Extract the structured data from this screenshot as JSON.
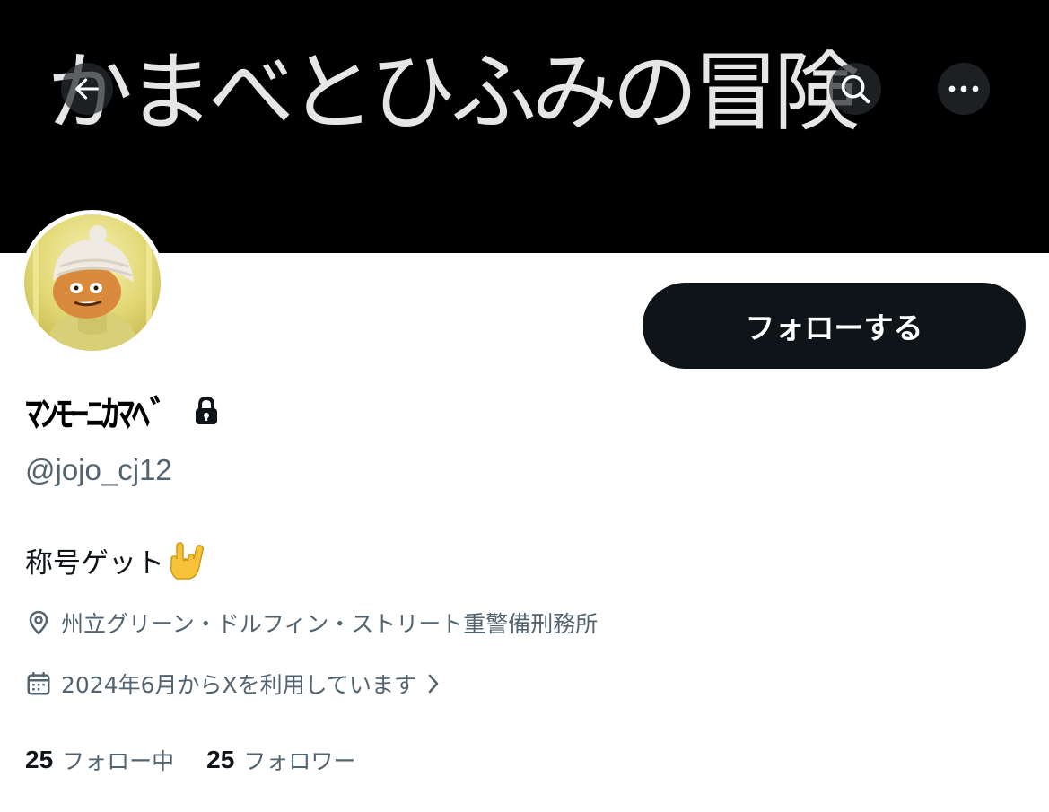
{
  "header": {
    "banner_text": "かまべとひふみの冒険",
    "back_icon": "arrow-left-icon",
    "search_icon": "search-icon",
    "more_icon": "more-icon"
  },
  "profile": {
    "avatar_icon": "avatar",
    "follow_label": "フォローする",
    "display_name": "ﾏﾝﾓｰﾆｶﾏﾍﾞ",
    "protected_icon": "lock-icon",
    "handle": "@jojo_cj12",
    "bio": "称号ゲット",
    "bio_emoji_icon": "love-you-gesture-emoji",
    "location": "州立グリーン・ドルフィン・ストリート重警備刑務所",
    "joined": "2024年6月からXを利用しています"
  },
  "stats": {
    "following_count": "25",
    "following_label": "フォロー中",
    "followers_count": "25",
    "followers_label": "フォロワー"
  },
  "colors": {
    "text_primary": "#0f1419",
    "text_secondary": "#536471",
    "button_bg": "#0f1419",
    "banner_bg": "#000000"
  }
}
